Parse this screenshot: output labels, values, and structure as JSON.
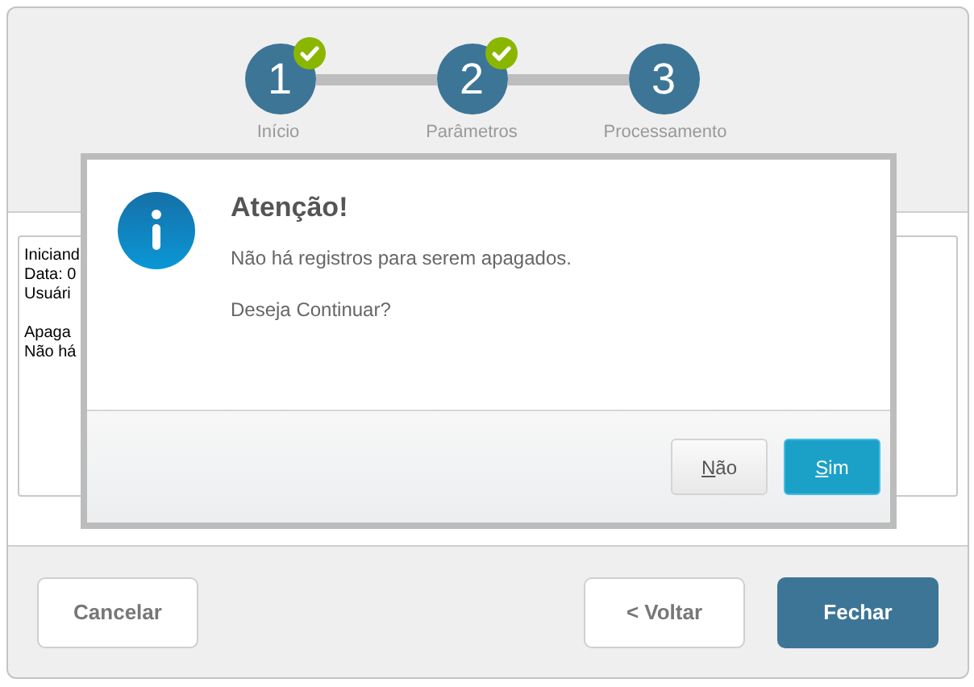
{
  "steps": [
    {
      "number": "1",
      "label": "Início",
      "done": true
    },
    {
      "number": "2",
      "label": "Parâmetros",
      "done": true
    },
    {
      "number": "3",
      "label": "Processamento",
      "done": false
    }
  ],
  "log": {
    "blocks": [
      [
        "Iniciand",
        "Data: 0",
        "Usuári"
      ],
      [
        "Apaga",
        "Não há"
      ]
    ]
  },
  "dialog": {
    "title": "Atenção!",
    "message": "Não há registros para serem apagados.",
    "question": "Deseja Continuar?",
    "buttons": [
      {
        "label": "Não",
        "primary": false
      },
      {
        "label": "Sim",
        "primary": true
      }
    ]
  },
  "footer": {
    "buttons": [
      {
        "label": "Cancelar",
        "primary": false
      },
      {
        "label": "< Voltar",
        "primary": false
      },
      {
        "label": "Fechar",
        "primary": true
      }
    ]
  }
}
